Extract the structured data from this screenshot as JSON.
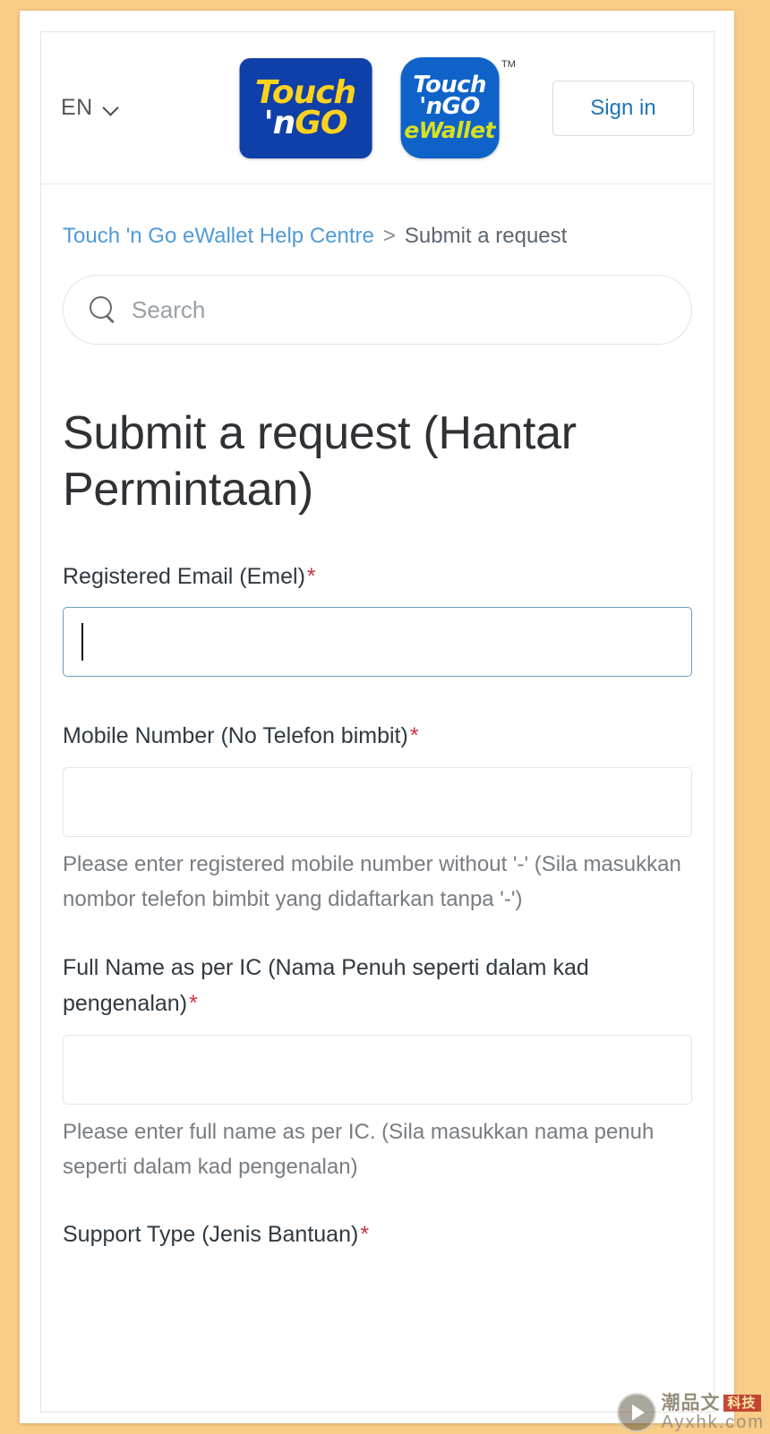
{
  "header": {
    "language": "EN",
    "language_icon": "chevron-down-icon",
    "signin_label": "Sign in",
    "logo_tng": {
      "line1": "Touch",
      "line2_apostrophe": "'n",
      "line2_go": "GO"
    },
    "logo_ewallet": {
      "line1": "Touch",
      "line2": "'nGO",
      "line3": "eWallet",
      "tm": "TM"
    }
  },
  "breadcrumb": {
    "home_label": "Touch 'n Go eWallet Help Centre",
    "separator": ">",
    "current_label": "Submit a request"
  },
  "search": {
    "placeholder": "Search",
    "value": "",
    "icon": "search-icon"
  },
  "main": {
    "title": "Submit a request (Hantar Permintaan)"
  },
  "form": {
    "required_marker": "*",
    "fields": [
      {
        "label": "Registered Email (Emel)",
        "required": true,
        "value": "",
        "hint": "",
        "focused": true
      },
      {
        "label": "Mobile Number (No Telefon bimbit)",
        "required": true,
        "value": "",
        "hint": "Please enter registered mobile number without '-' (Sila masukkan nombor telefon bimbit yang didaftarkan tanpa '-')",
        "focused": false
      },
      {
        "label": "Full Name as per IC (Nama Penuh seperti dalam kad pengenalan)",
        "required": true,
        "value": "",
        "hint": "Please enter full name as per IC. (Sila masukkan nama penuh seperti dalam kad pengenalan)",
        "focused": false
      },
      {
        "label": "Support Type (Jenis Bantuan)",
        "required": true,
        "value": "",
        "hint": "",
        "focused": false
      }
    ]
  },
  "watermark": {
    "chinese": "潮品文",
    "badge": "科技",
    "url": "Ayxhk.com",
    "icon": "play-button-icon"
  },
  "colors": {
    "page_background": "#f9cc87",
    "link_blue": "#4f9bd9",
    "signin_blue": "#1f73b7",
    "required_red": "#cc3340",
    "logo_blue": "#0f3fa8",
    "logo_yellow": "#ffd21e",
    "ewallet_blue": "#0f63c8",
    "ewallet_green": "#d7e021",
    "focus_border": "#6b9dba"
  }
}
